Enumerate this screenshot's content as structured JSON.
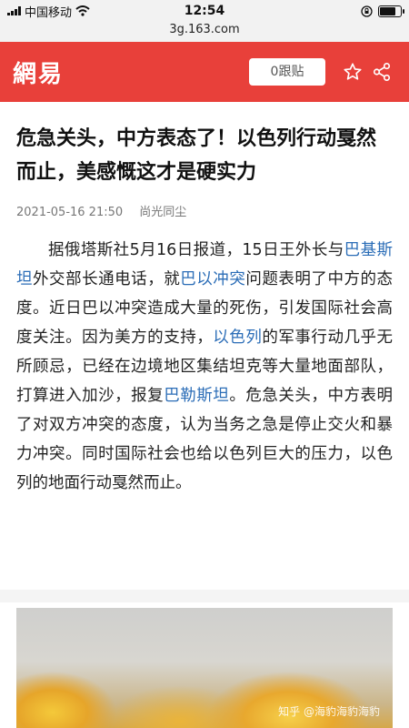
{
  "status_bar": {
    "carrier": "中国移动",
    "time": "12:54"
  },
  "browser": {
    "url": "3g.163.com"
  },
  "header": {
    "logo": "網易",
    "comments_label": "0跟贴",
    "brand_color": "#e8403a"
  },
  "article": {
    "title": "危急关头，中方表态了！以色列行动戛然而止，美感慨这才是硬实力",
    "date": "2021-05-16 21:50",
    "author": "尚光同尘",
    "paragraph": {
      "p1": "据俄塔斯社5月16日报道，15日王外长与",
      "link1": "巴基斯坦",
      "p2": "外交部长通电话，就",
      "link2": "巴以冲突",
      "p3": "问题表明了中方的态度。近日巴以冲突造成大量的死伤，引发国际社会高度关注。因为美方的支持，",
      "link3": "以色列",
      "p4": "的军事行动几乎无所顾忌，已经在边境地区集结坦克等大量地面部队，打算进入加沙，报复",
      "link4": "巴勒斯坦",
      "p5": "。危急关头，中方表明了对双方冲突的态度，认为当务之急是停止交火和暴力冲突。同时国际社会也给以色列巨大的压力，以色列的地面行动戛然而止。"
    }
  },
  "watermark": "知乎 @海豹海豹海豹"
}
